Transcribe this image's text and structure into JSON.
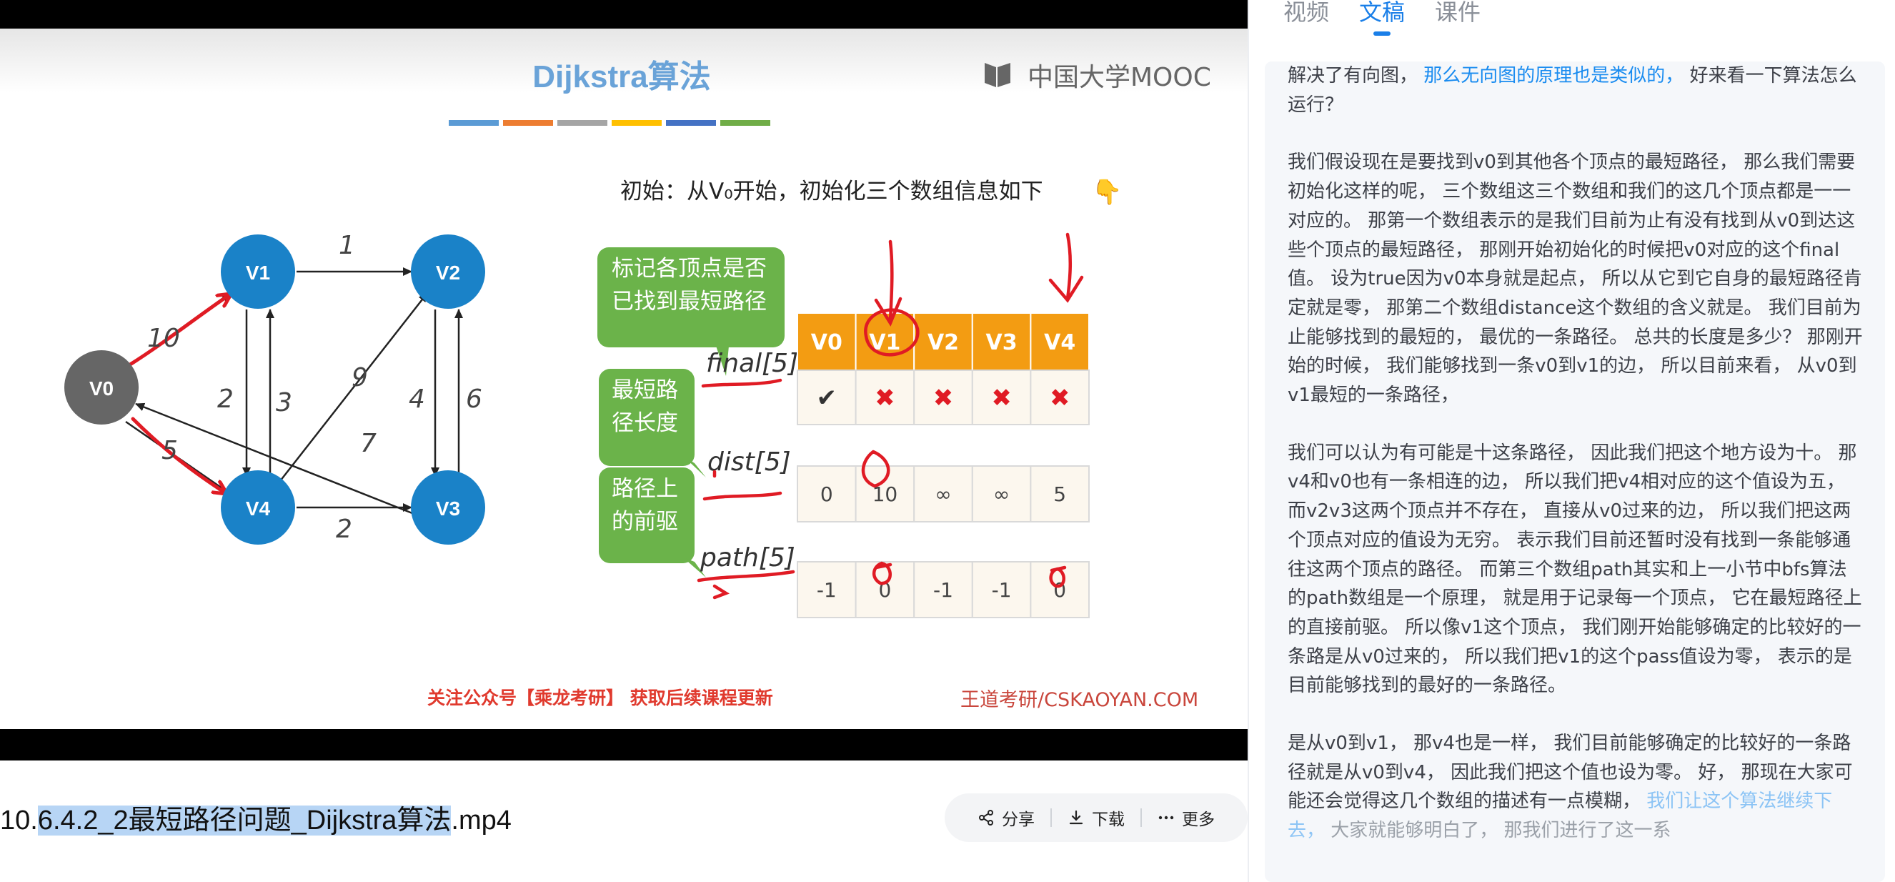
{
  "slide": {
    "title": "Dijkstra算法",
    "logo": "中国大学MOOC",
    "title_bar_colors": [
      "#5b9bd5",
      "#ed7d31",
      "#a5a5a5",
      "#ffc000",
      "#4472c4",
      "#70ad47"
    ],
    "init_text": "初始：从V₀开始，初始化三个数组信息如下",
    "graph": {
      "nodes": [
        {
          "id": "V0",
          "label": "V0",
          "color": "#666666"
        },
        {
          "id": "V1",
          "label": "V1",
          "color": "#1a82c8"
        },
        {
          "id": "V2",
          "label": "V2",
          "color": "#1a82c8"
        },
        {
          "id": "V3",
          "label": "V3",
          "color": "#1a82c8"
        },
        {
          "id": "V4",
          "label": "V4",
          "color": "#1a82c8"
        }
      ],
      "edge_weights": {
        "v0_v1": "10",
        "v1_v2": "1",
        "v1_v4": "2",
        "v4_v1": "3",
        "v4_v2": "9",
        "v2_v3": "4",
        "v3_v2": "6",
        "v3_v0": "7",
        "v0_v4": "5",
        "v4_v3": "2"
      }
    },
    "callouts": {
      "final": "标记各顶点是否已找到最短路径",
      "dist": "最短路径长度",
      "path": "路径上的前驱"
    },
    "array_labels": {
      "final": "final[5]",
      "dist": "dist[5]",
      "path": "path[5]"
    },
    "table": {
      "headers": [
        "V0",
        "V1",
        "V2",
        "V3",
        "V4"
      ],
      "final": [
        "✔",
        "✖",
        "✖",
        "✖",
        "✖"
      ],
      "dist": [
        "0",
        "10",
        "∞",
        "∞",
        "5"
      ],
      "path": [
        "-1",
        "0",
        "-1",
        "-1",
        "0"
      ]
    },
    "footer_left": "关注公众号【乘龙考研】 获取后续课程更新",
    "footer_right": "王道考研/CSKAOYAN.COM"
  },
  "file_title": {
    "prefix": "10.",
    "highlight": "6.4.2_2最短路径问题_Dijkstra算法",
    "suffix": ".mp4"
  },
  "actions": {
    "share": "分享",
    "download": "下载",
    "more": "更多"
  },
  "tabs": [
    "视频",
    "文稿",
    "课件"
  ],
  "active_tab": "文稿",
  "transcript": {
    "p1_a": "解决了有向图，",
    "p1_b": "那么无向图的原理也是类似的，",
    "p1_c": "好来看一下算法怎么运行？",
    "p2": "我们假设现在是要找到v0到其他各个顶点的最短路径， 那么我们需要初始化这样的呢， 三个数组这三个数组和我们的这几个顶点都是一一对应的。 那第一个数组表示的是我们目前为止有没有找到从v0到达这些个顶点的最短路径， 那刚开始初始化的时候把v0对应的这个final值。 设为true因为v0本身就是起点， 所以从它到它自身的最短路径肯定就是零， 那第二个数组distance这个数组的含义就是。 我们目前为止能够找到的最短的， 最优的一条路径。 总共的长度是多少？ 那刚开始的时候， 我们能够找到一条v0到v1的边， 所以目前来看， 从v0到v1最短的一条路径，",
    "p3": "我们可以认为有可能是十这条路径， 因此我们把这个地方设为十。 那v4和v0也有一条相连的边， 所以我们把v4相对应的这个值设为五， 而v2v3这两个顶点并不存在， 直接从v0过来的边， 所以我们把这两个顶点对应的值设为无穷。 表示我们目前还暂时没有找到一条能够通往这两个顶点的路径。 而第三个数组path其实和上一小节中bfs算法的path数组是一个原理， 就是用于记录每一个顶点， 它在最短路径上的直接前驱。 所以像v1这个顶点， 我们刚开始能够确定的比较好的一条路是从v0过来的， 所以我们把v1的这个pass值设为零， 表示的是目前能够找到的最好的一条路径。",
    "p4_a": "是从v0到v1， 那v4也是一样， 我们目前能够确定的比较好的一条路径就是从v0到v4， 因此我们把这个值也设为零。 好， 那现在大家可能还会觉得这几个数组的描述有一点模糊，",
    "p4_b": "我们让这个算法继续下去，",
    "p4_c": "大家就能够明白了， 那我们进行了这一系"
  }
}
